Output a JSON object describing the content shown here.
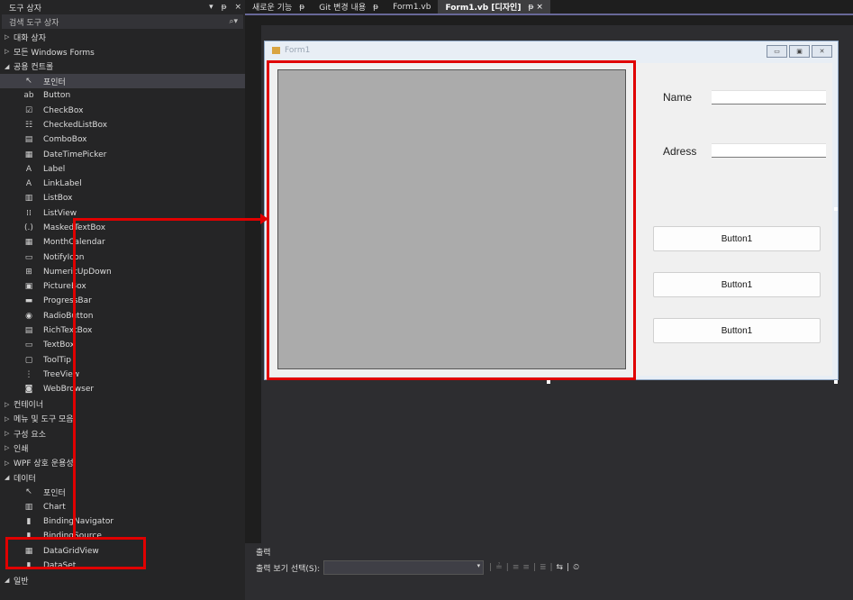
{
  "toolbox": {
    "title": "도구 상자",
    "header_controls": [
      "▾",
      "ᵽ",
      "×"
    ],
    "search_placeholder": "검색 도구 상자",
    "search_icon": "search-icon",
    "groups_top": [
      {
        "type": "cat",
        "label": "대화 상자",
        "state": "collapsed"
      },
      {
        "type": "cat",
        "label": "모든 Windows Forms",
        "state": "collapsed"
      },
      {
        "type": "cat",
        "label": "공용 컨트롤",
        "state": "expanded"
      },
      {
        "type": "item",
        "label": "포인터",
        "icon": "↖",
        "selected": true
      },
      {
        "type": "item",
        "label": "Button",
        "icon": "ab"
      },
      {
        "type": "item",
        "label": "CheckBox",
        "icon": "☑"
      },
      {
        "type": "item",
        "label": "CheckedListBox",
        "icon": "☷"
      },
      {
        "type": "item",
        "label": "ComboBox",
        "icon": "▤"
      },
      {
        "type": "item",
        "label": "DateTimePicker",
        "icon": "▦"
      },
      {
        "type": "item",
        "label": "Label",
        "icon": "A"
      },
      {
        "type": "item",
        "label": "LinkLabel",
        "icon": "A"
      },
      {
        "type": "item",
        "label": "ListBox",
        "icon": "▥"
      },
      {
        "type": "item",
        "label": "ListView",
        "icon": "⁞⁞"
      },
      {
        "type": "item",
        "label": "MaskedTextBox",
        "icon": "(.)"
      },
      {
        "type": "item",
        "label": "MonthCalendar",
        "icon": "▦"
      },
      {
        "type": "item",
        "label": "NotifyIcon",
        "icon": "▭"
      },
      {
        "type": "item",
        "label": "NumericUpDown",
        "icon": "⊞"
      },
      {
        "type": "item",
        "label": "PictureBox",
        "icon": "▣"
      },
      {
        "type": "item",
        "label": "ProgressBar",
        "icon": "▬"
      },
      {
        "type": "item",
        "label": "RadioButton",
        "icon": "◉"
      },
      {
        "type": "item",
        "label": "RichTextBox",
        "icon": "▤"
      },
      {
        "type": "item",
        "label": "TextBox",
        "icon": "▭"
      },
      {
        "type": "item",
        "label": "ToolTip",
        "icon": "▢"
      },
      {
        "type": "item",
        "label": "TreeView",
        "icon": "⋮"
      },
      {
        "type": "item",
        "label": "WebBrowser",
        "icon": "◙"
      },
      {
        "type": "cat",
        "label": "컨테이너",
        "state": "collapsed"
      },
      {
        "type": "cat",
        "label": "메뉴 및 도구 모음",
        "state": "collapsed"
      },
      {
        "type": "cat",
        "label": "구성 요소",
        "state": "collapsed"
      },
      {
        "type": "cat",
        "label": "인쇄",
        "state": "collapsed"
      },
      {
        "type": "cat",
        "label": "WPF 상호 운용성",
        "state": "collapsed"
      },
      {
        "type": "cat",
        "label": "데이터",
        "state": "expanded"
      },
      {
        "type": "item",
        "label": "포인터",
        "icon": "↖"
      },
      {
        "type": "item",
        "label": "Chart",
        "icon": "▥"
      },
      {
        "type": "item",
        "label": "BindingNavigator",
        "icon": "▮"
      },
      {
        "type": "item",
        "label": "BindingSource",
        "icon": "▮"
      },
      {
        "type": "item",
        "label": "DataGridView",
        "icon": "▦"
      },
      {
        "type": "item",
        "label": "DataSet",
        "icon": "▮"
      },
      {
        "type": "cat",
        "label": "일반",
        "state": "expanded"
      }
    ]
  },
  "tabs": [
    {
      "label": "새로운 기능",
      "pin": "ᵽ",
      "active": false
    },
    {
      "label": "Git 변경 내용",
      "pin": "ᵽ",
      "active": false
    },
    {
      "label": "Form1.vb",
      "pin": "",
      "active": false
    },
    {
      "label": "Form1.vb [디자인]",
      "pin": "ᵽ ×",
      "active": true
    }
  ],
  "form": {
    "title": "Form1",
    "win_buttons": [
      "▭",
      "▣",
      "✕"
    ],
    "name_label": "Name",
    "address_label": "Adress",
    "buttons": [
      "Button1",
      "Button1",
      "Button1"
    ]
  },
  "output": {
    "title": "출력",
    "show_label": "출력 보기 선택(S):",
    "icons": [
      "|",
      "≟",
      "|",
      "≡",
      "≡",
      "|",
      "≣",
      "|",
      "⇆",
      "|",
      "⏲"
    ]
  },
  "colors": {
    "highlight": "#e00000",
    "accent": "#686898"
  }
}
